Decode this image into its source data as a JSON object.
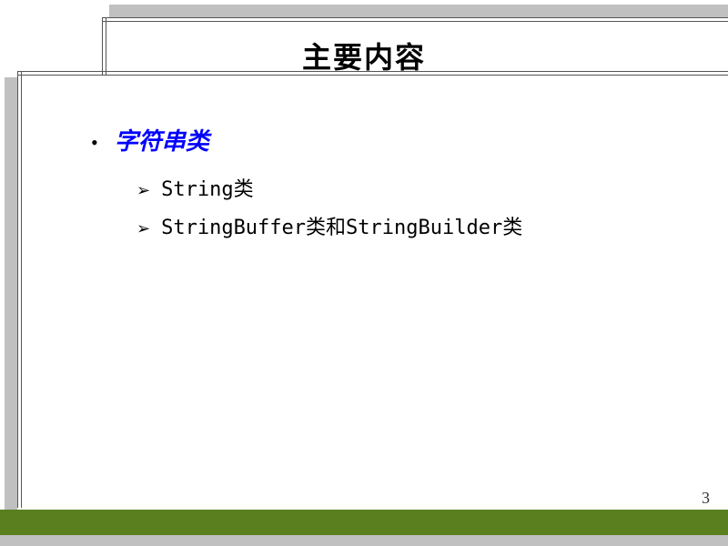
{
  "slide": {
    "title": "主要内容",
    "main_bullet": {
      "marker": "•",
      "text": "字符串类"
    },
    "sub_bullets": [
      {
        "marker": "➢",
        "text": "String类"
      },
      {
        "marker": "➢",
        "text": "StringBuffer类和StringBuilder类"
      }
    ],
    "page_number": "3"
  }
}
